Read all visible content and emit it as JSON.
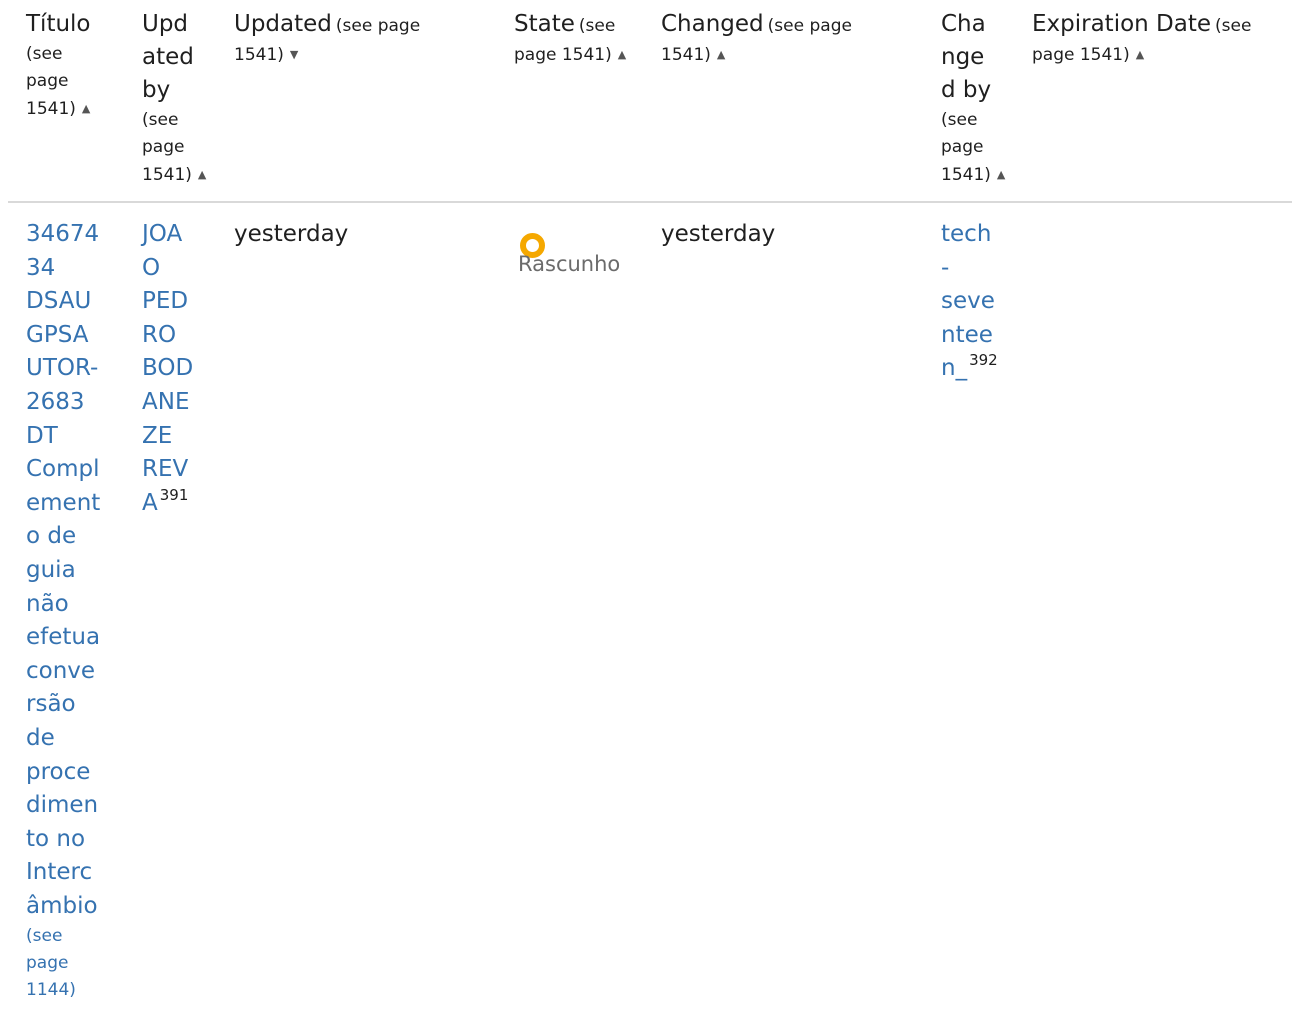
{
  "headers": [
    {
      "lines": [
        "Título"
      ],
      "sub": [
        "(see",
        "page",
        "1541)"
      ],
      "arrow": "▲"
    },
    {
      "lines": [
        "Upd",
        "ated",
        "by"
      ],
      "sub": [
        "(see",
        "page",
        "1541)"
      ],
      "arrow": "▲"
    },
    {
      "main": "Updated",
      "sub_inline": "(see page",
      "sub2": "1541)",
      "arrow": "▼"
    },
    {
      "main": "State",
      "sub_inline": "(see",
      "sub2": "page 1541)",
      "arrow": "▲"
    },
    {
      "main": "Changed",
      "sub_inline": "(see page",
      "sub2": "1541)",
      "arrow": "▲"
    },
    {
      "lines": [
        "Cha",
        "nge",
        "d by"
      ],
      "sub": [
        "(see",
        "page",
        "1541)"
      ],
      "arrow": "▲"
    },
    {
      "main": "Expiration Date",
      "sub_inline": "(see",
      "sub2": "page 1541)",
      "arrow": "▲"
    }
  ],
  "row": {
    "title_lines": [
      "34674",
      "34",
      "DSAU",
      "GPSA",
      "UTOR-",
      "2683",
      "DT",
      "Compl",
      "ement",
      "o de",
      "guia",
      "não",
      "efetua",
      "conve",
      "rsão",
      "de",
      "proce",
      "dimen",
      "to no",
      "Interc",
      "âmbio"
    ],
    "title_ref": [
      "(see",
      "page",
      "1144)"
    ],
    "updated_by_lines": [
      "JOA",
      "O",
      "PED",
      "RO",
      "BOD",
      "ANE",
      "ZE",
      "REV",
      "A"
    ],
    "updated_by_footnote": "391",
    "updated": "yesterday",
    "state_label": "Rascunho",
    "state_color": "#f5a800",
    "changed": "yesterday",
    "changed_by_lines": [
      "tech",
      "-",
      "seve",
      "ntee",
      "n_"
    ],
    "changed_by_footnote": "392",
    "expiration": ""
  }
}
